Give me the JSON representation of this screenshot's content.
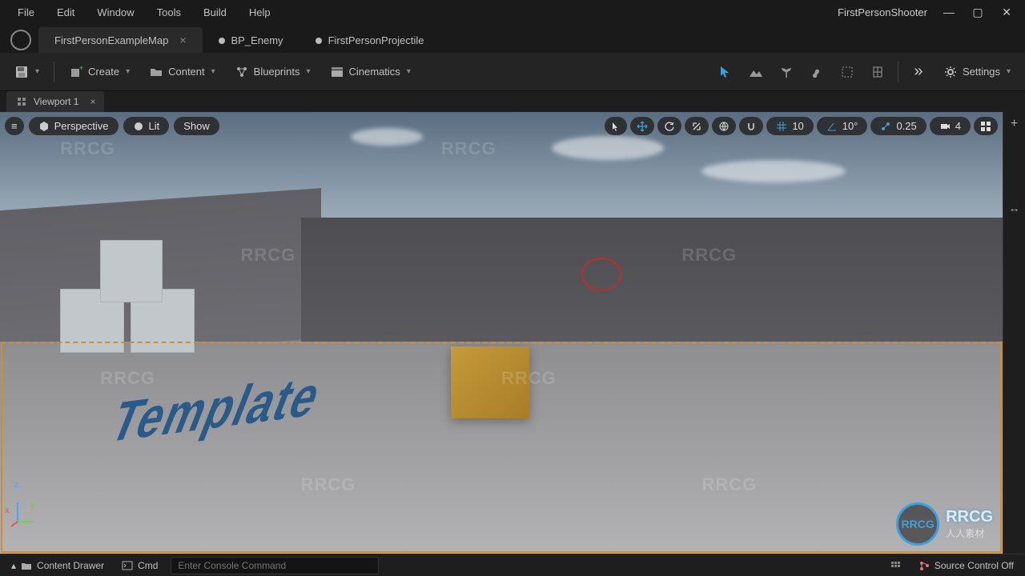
{
  "menu": {
    "items": [
      "File",
      "Edit",
      "Window",
      "Tools",
      "Build",
      "Help"
    ]
  },
  "project": {
    "name": "FirstPersonShooter"
  },
  "window_ctrl": {
    "min": "—",
    "max": "▢",
    "close": "✕"
  },
  "tabs": [
    {
      "label": "FirstPersonExampleMap",
      "active": true,
      "dirty": false
    },
    {
      "label": "BP_Enemy",
      "active": false,
      "dirty": true
    },
    {
      "label": "FirstPersonProjectile",
      "active": false,
      "dirty": true
    }
  ],
  "toolbar": {
    "save_icon": "save",
    "create": "Create",
    "content": "Content",
    "blueprints": "Blueprints",
    "cinematics": "Cinematics",
    "settings": "Settings"
  },
  "sub_tab": {
    "label": "Viewport 1",
    "close": "×"
  },
  "viewport": {
    "perspective": "Perspective",
    "lit": "Lit",
    "show": "Show",
    "grid_snap": "10",
    "angle_snap": "10°",
    "scale_snap": "0.25",
    "camera_speed": "4"
  },
  "scene": {
    "floor_text": "Template",
    "axes": {
      "x": "x",
      "y": "y",
      "z": "z"
    }
  },
  "bottom": {
    "content_drawer": "Content Drawer",
    "cmd_label": "Cmd",
    "cmd_placeholder": "Enter Console Command",
    "source_control": "Source Control Off"
  },
  "watermark": {
    "text": "RRCG",
    "brand": "RRCG",
    "brand_sub": "人人素材"
  }
}
